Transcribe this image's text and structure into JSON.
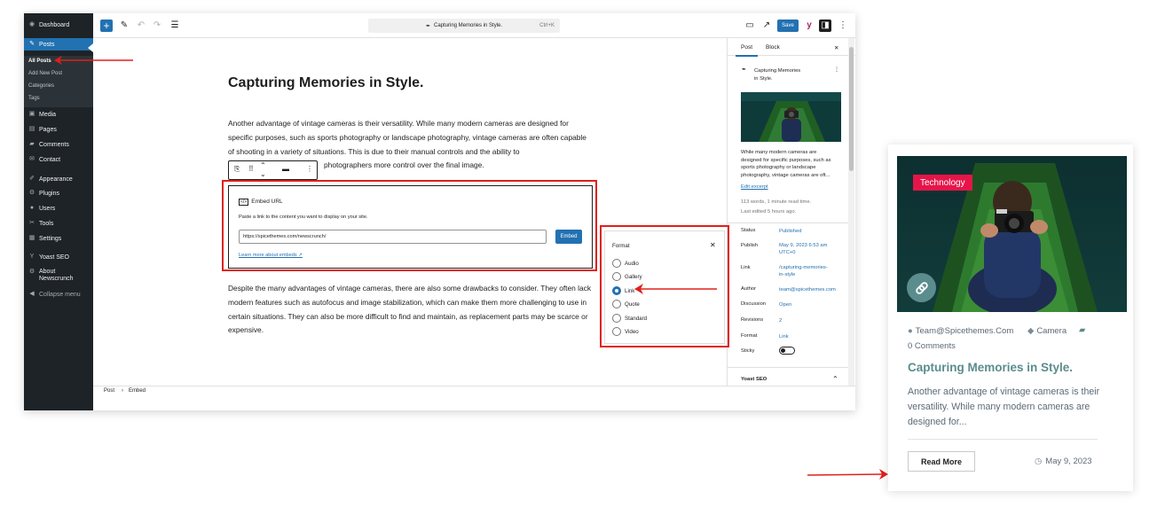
{
  "admin_menu": {
    "items": [
      {
        "label": "Dashboard",
        "icon": "dashboard-icon",
        "glyph": "◉"
      },
      {
        "label": "Posts",
        "icon": "pin-icon",
        "glyph": "✎",
        "active": true
      },
      {
        "label": "Media",
        "icon": "media-icon",
        "glyph": "▣"
      },
      {
        "label": "Pages",
        "icon": "pages-icon",
        "glyph": "▤"
      },
      {
        "label": "Comments",
        "icon": "comments-icon",
        "glyph": "▰"
      },
      {
        "label": "Contact",
        "icon": "mail-icon",
        "glyph": "✉"
      },
      {
        "label": "Appearance",
        "icon": "brush-icon",
        "glyph": "✐"
      },
      {
        "label": "Plugins",
        "icon": "plugin-icon",
        "glyph": "⚙"
      },
      {
        "label": "Users",
        "icon": "users-icon",
        "glyph": "●"
      },
      {
        "label": "Tools",
        "icon": "wrench-icon",
        "glyph": "✂"
      },
      {
        "label": "Settings",
        "icon": "settings-icon",
        "glyph": "▦"
      },
      {
        "label": "Yoast SEO",
        "icon": "yoast-icon",
        "glyph": "Y"
      },
      {
        "label": "About",
        "label2": "Newscrunch",
        "icon": "about-icon",
        "glyph": "⚙"
      },
      {
        "label": "Collapse menu",
        "icon": "collapse-icon",
        "glyph": "◀"
      }
    ],
    "submenu": [
      "All Posts",
      "Add New Post",
      "Categories",
      "Tags"
    ]
  },
  "toolbar": {
    "command_title": "Capturing Memories in Style.",
    "shortcut": "Ctrl+K",
    "save_label": "Save"
  },
  "post": {
    "title": "Capturing Memories in Style.",
    "para1": "Another advantage of vintage cameras is their versatility. While many modern cameras are designed for specific purposes, such as sports photography or landscape photography, vintage cameras are often capable of shooting in a variety of situations. This is due to their manual controls and the ability to",
    "para1_tail": "photographers more control over the final image.",
    "para2": "Despite the many advantages of vintage cameras, there are also some drawbacks to consider. They often lack modern features such as autofocus and image stabilization, which can make them more challenging to use in certain situations. They can also be more difficult to find and maintain, as replacement parts may be scarce or expensive."
  },
  "embed": {
    "label": "Embed URL",
    "description": "Paste a link to the content you want to display on your site.",
    "url_value": "https://spicethemes.com/newscrunch/",
    "button": "Embed",
    "learn_more": "Learn more about embeds ↗"
  },
  "sidebar": {
    "tabs": [
      "Post",
      "Block"
    ],
    "summary_title_l1": "Capturing Memories",
    "summary_title_l2": "in Style.",
    "excerpt": [
      "While many modern cameras are",
      "designed for specific purposes, such as",
      "sports photography or landscape",
      "photography, vintage cameras are oft..."
    ],
    "edit_excerpt": "Edit excerpt",
    "word_count": "113 words, 1 minute read time.",
    "last_edited": "Last edited 5 hours ago.",
    "rows": [
      {
        "label": "Status",
        "value": "Published"
      },
      {
        "label": "Publish",
        "value": "May 9, 2023 6:53 am",
        "value2": "UTC+0"
      },
      {
        "label": "Link",
        "value": "/capturing-memories-",
        "value2": "in-style"
      },
      {
        "label": "Author",
        "value": "team@spicethemes.com"
      },
      {
        "label": "Discussion",
        "value": "Open"
      },
      {
        "label": "Revisions",
        "value": "2"
      },
      {
        "label": "Format",
        "value": "Link"
      },
      {
        "label": "Sticky",
        "value": ""
      }
    ],
    "yoast": "Yoast SEO"
  },
  "statusbar": {
    "crumb1": "Post",
    "sep": "›",
    "crumb2": "Embed"
  },
  "format_popup": {
    "title": "Format",
    "options": [
      "Audio",
      "Gallery",
      "Link",
      "Quote",
      "Standard",
      "Video"
    ],
    "selected": "Link"
  },
  "card": {
    "tag": "Technology",
    "author": "Team@Spicethemes.Com",
    "category": "Camera",
    "comments": "0 Comments",
    "title": "Capturing Memories in Style.",
    "excerpt": "Another advantage of vintage cameras is their versatility. While many modern cameras are designed for...",
    "read_more": "Read More",
    "date": "May 9, 2023"
  },
  "colors": {
    "accent": "#2271b1",
    "admin_bg": "#1d2327",
    "highlight": "#e0201b",
    "tag": "#e5154a",
    "card_title": "#5b8c8c"
  }
}
